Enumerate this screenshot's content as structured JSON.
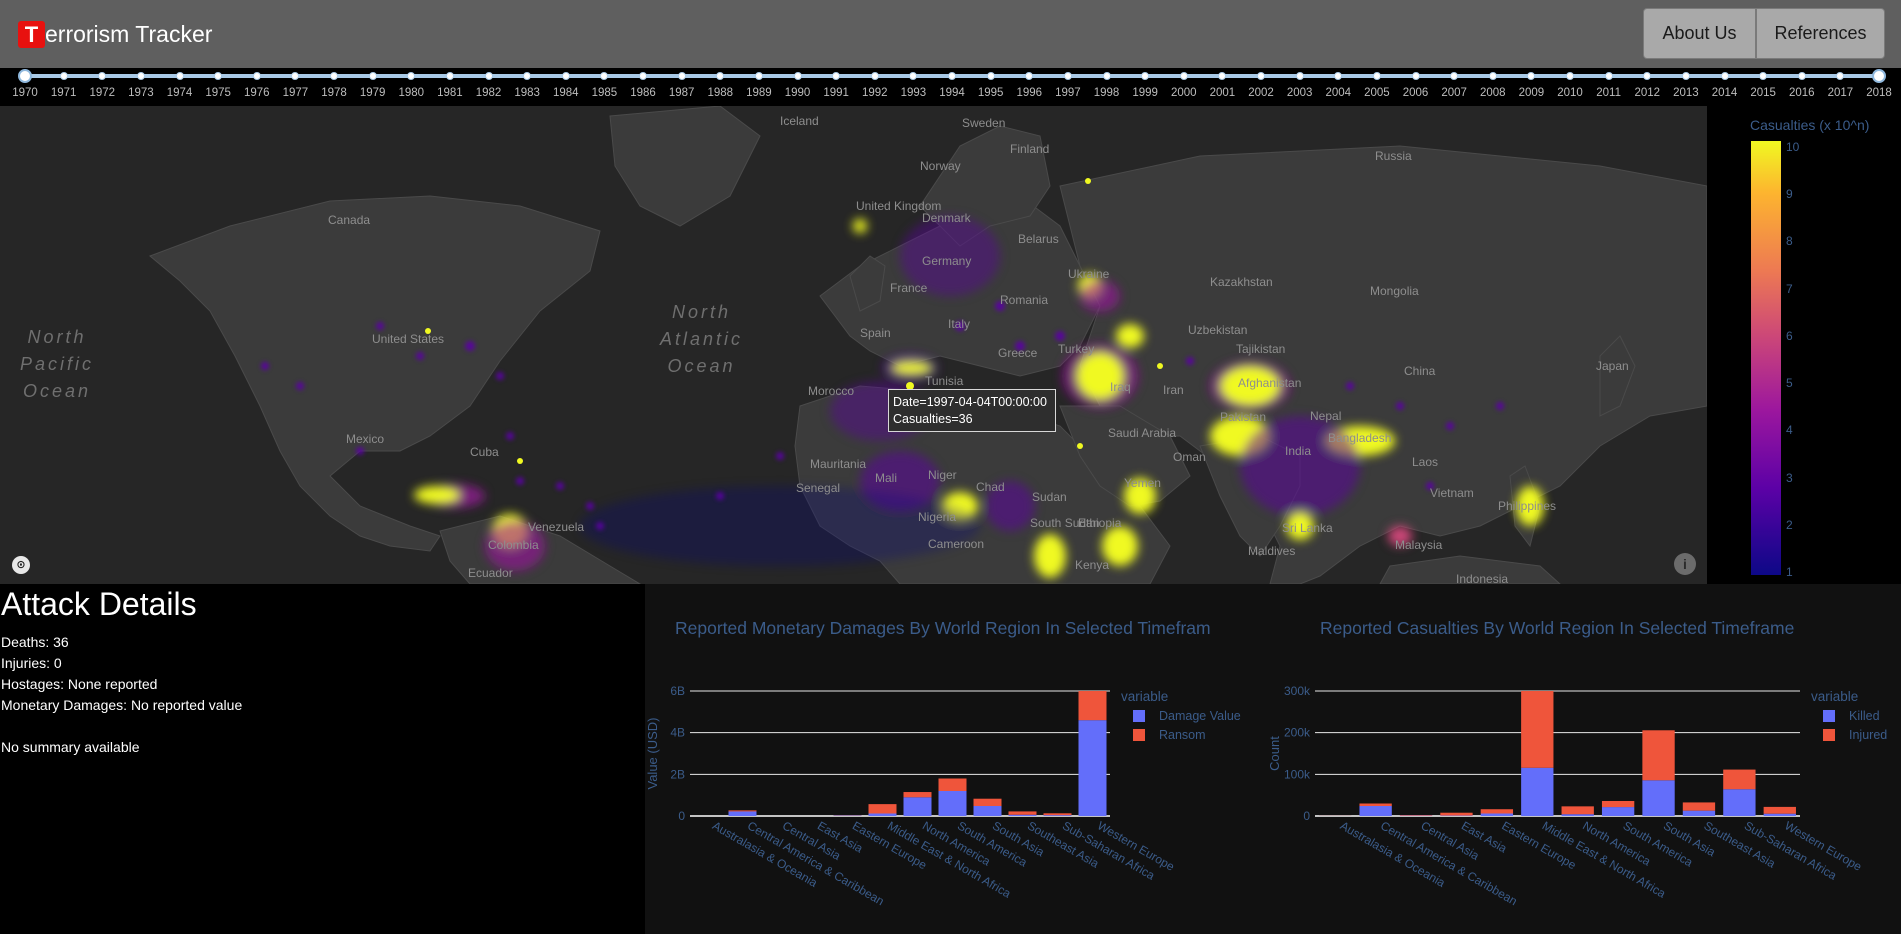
{
  "header": {
    "logo_letter": "T",
    "title": "errorism Tracker",
    "about_label": "About Us",
    "references_label": "References"
  },
  "timeline": {
    "years": [
      "1970",
      "1971",
      "1972",
      "1973",
      "1974",
      "1975",
      "1976",
      "1977",
      "1978",
      "1979",
      "1980",
      "1981",
      "1982",
      "1983",
      "1984",
      "1985",
      "1986",
      "1987",
      "1988",
      "1989",
      "1990",
      "1991",
      "1992",
      "1993",
      "1994",
      "1995",
      "1996",
      "1997",
      "1998",
      "1999",
      "2000",
      "2001",
      "2002",
      "2003",
      "2004",
      "2005",
      "2006",
      "2007",
      "2008",
      "2009",
      "2010",
      "2011",
      "2012",
      "2013",
      "2014",
      "2015",
      "2016",
      "2017",
      "2018"
    ],
    "range_start": "1970",
    "range_end": "2018"
  },
  "map": {
    "place_labels": [
      "Iceland",
      "Sweden",
      "Finland",
      "Norway",
      "Russia",
      "Canada",
      "United Kingdom",
      "Denmark",
      "Belarus",
      "Germany",
      "Ukraine",
      "France",
      "Kazakhstan",
      "Mongolia",
      "Romania",
      "Spain",
      "Italy",
      "Uzbekistan",
      "Greece",
      "Turkey",
      "Tajikistan",
      "China",
      "United States",
      "Japan",
      "Morocco",
      "Iraq",
      "Iran",
      "Afghanistan",
      "Pakistan",
      "Nepal",
      "Bangladesh",
      "Mexico",
      "Cuba",
      "Saudi Arabia",
      "Oman",
      "India",
      "Laos",
      "Mauritania",
      "Mali",
      "Niger",
      "Senegal",
      "Chad",
      "Sudan",
      "Yemen",
      "Vietnam",
      "Philippines",
      "Venezuela",
      "Nigeria",
      "South Sudan",
      "Ethiopia",
      "Sri Lanka",
      "Colombia",
      "Cameroon",
      "Malaysia",
      "Maldives",
      "Kenya",
      "Ecuador",
      "Indonesia",
      "Tunisia"
    ],
    "ocean_labels": [
      "North\nPacific\nOcean",
      "North\nAtlantic\nOcean"
    ],
    "tooltip_date": "Date=1997-04-04T00:00:00",
    "tooltip_value": "Casualties=36",
    "colorbar_title": "Casualties (x 10^n)",
    "colorbar_ticks": [
      "10",
      "9",
      "8",
      "7",
      "6",
      "5",
      "4",
      "3",
      "2",
      "1"
    ],
    "colors": {
      "low": "#0d0887",
      "mid": "#cc4778",
      "high": "#f0f921"
    }
  },
  "details": {
    "heading": "Attack Details",
    "deaths": "Deaths: 36",
    "injuries": "Injuries: 0",
    "hostages": "Hostages: None reported",
    "damages": "Monetary Damages: No reported value",
    "summary": "No summary available"
  },
  "chart_data": [
    {
      "type": "bar",
      "title": "Reported Monetary Damages By World Region In Selected Timefram",
      "xlabel": "",
      "ylabel": "Value (USD)",
      "ylim": [
        0,
        6000000000
      ],
      "yticks": [
        "0",
        "2B",
        "4B",
        "6B"
      ],
      "legend_title": "variable",
      "categories": [
        "Australasia & Oceania",
        "Central America & Caribbean",
        "Central Asia",
        "East Asia",
        "Eastern Europe",
        "Middle East & North Africa",
        "North America",
        "South America",
        "South Asia",
        "Southeast Asia",
        "Sub-Saharan Africa",
        "Western Europe"
      ],
      "series": [
        {
          "name": "Damage Value",
          "color": "#636efa",
          "values": [
            0,
            220000000,
            0,
            0,
            20000000,
            120000000,
            900000000,
            1200000000,
            480000000,
            60000000,
            40000000,
            4600000000
          ]
        },
        {
          "name": "Ransom",
          "color": "#ef553b",
          "values": [
            0,
            50000000,
            0,
            0,
            10000000,
            450000000,
            250000000,
            600000000,
            350000000,
            160000000,
            90000000,
            1400000000
          ]
        }
      ]
    },
    {
      "type": "bar",
      "title": "Reported Casualties By World Region In Selected Timeframe",
      "xlabel": "",
      "ylabel": "Count",
      "ylim": [
        0,
        350000
      ],
      "yticks": [
        "0",
        "100k",
        "200k",
        "300k"
      ],
      "legend_title": "variable",
      "categories": [
        "Australasia & Oceania",
        "Central America & Caribbean",
        "Central Asia",
        "East Asia",
        "Eastern Europe",
        "Middle East & North Africa",
        "North America",
        "South America",
        "South Asia",
        "Southeast Asia",
        "Sub-Saharan Africa",
        "Western Europe"
      ],
      "series": [
        {
          "name": "Killed",
          "color": "#636efa",
          "values": [
            150,
            28000,
            1000,
            1200,
            7000,
            135000,
            5000,
            25000,
            100000,
            15000,
            75000,
            6500
          ]
        },
        {
          "name": "Injured",
          "color": "#ef553b",
          "values": [
            300,
            7000,
            1500,
            8000,
            12000,
            215000,
            22000,
            17000,
            140000,
            23000,
            55000,
            19000
          ]
        }
      ]
    }
  ]
}
